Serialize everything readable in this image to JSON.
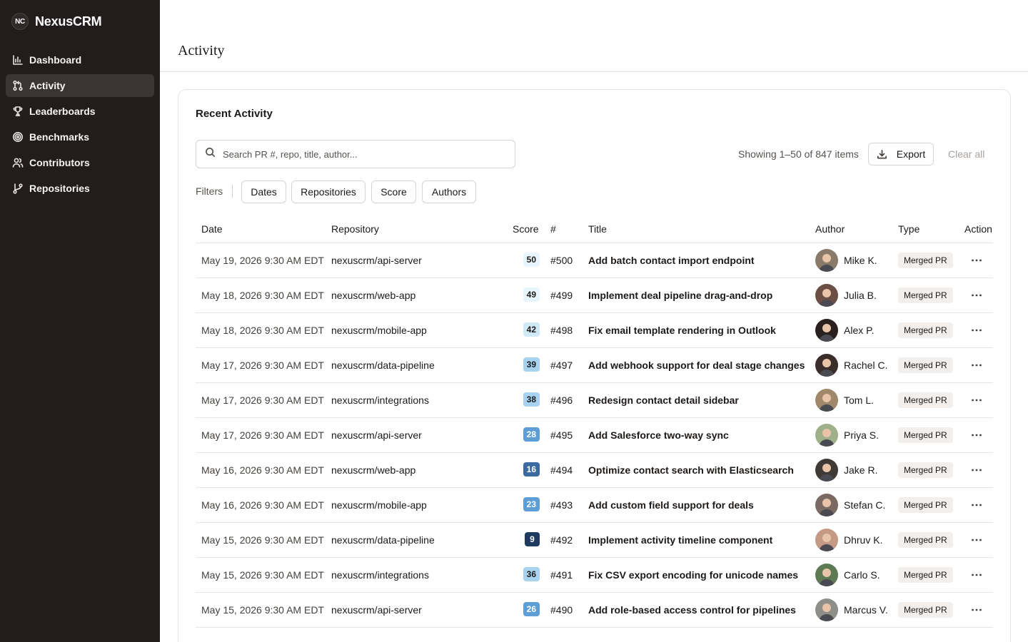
{
  "app": {
    "logo_text": "NC",
    "name": "NexusCRM"
  },
  "sidebar": {
    "items": [
      {
        "label": "Dashboard",
        "icon": "bar-chart-icon",
        "active": false
      },
      {
        "label": "Activity",
        "icon": "git-pull-request-icon",
        "active": true
      },
      {
        "label": "Leaderboards",
        "icon": "trophy-icon",
        "active": false
      },
      {
        "label": "Benchmarks",
        "icon": "target-icon",
        "active": false
      },
      {
        "label": "Contributors",
        "icon": "users-icon",
        "active": false
      },
      {
        "label": "Repositories",
        "icon": "git-branch-icon",
        "active": false
      }
    ]
  },
  "page": {
    "title": "Activity"
  },
  "card": {
    "title": "Recent Activity",
    "search_placeholder": "Search PR #, repo, title, author...",
    "showing": "Showing 1–50 of 847 items",
    "export_label": "Export",
    "clear_label": "Clear all",
    "filters_label": "Filters",
    "filters": [
      "Dates",
      "Repositories",
      "Score",
      "Authors"
    ]
  },
  "table": {
    "headers": [
      "Date",
      "Repository",
      "Score",
      "#",
      "Title",
      "Author",
      "Type",
      "Action"
    ],
    "rows": [
      {
        "date": "May 19, 2026 9:30 AM EDT",
        "repo": "nexuscrm/api-server",
        "score": "50",
        "num": "#500",
        "title": "Add batch contact import endpoint",
        "author": "Mike K.",
        "type": "Merged PR"
      },
      {
        "date": "May 18, 2026 9:30 AM EDT",
        "repo": "nexuscrm/web-app",
        "score": "49",
        "num": "#499",
        "title": "Implement deal pipeline drag-and-drop",
        "author": "Julia B.",
        "type": "Merged PR"
      },
      {
        "date": "May 18, 2026 9:30 AM EDT",
        "repo": "nexuscrm/mobile-app",
        "score": "42",
        "num": "#498",
        "title": "Fix email template rendering in Outlook",
        "author": "Alex P.",
        "type": "Merged PR"
      },
      {
        "date": "May 17, 2026 9:30 AM EDT",
        "repo": "nexuscrm/data-pipeline",
        "score": "39",
        "num": "#497",
        "title": "Add webhook support for deal stage changes",
        "author": "Rachel C.",
        "type": "Merged PR"
      },
      {
        "date": "May 17, 2026 9:30 AM EDT",
        "repo": "nexuscrm/integrations",
        "score": "38",
        "num": "#496",
        "title": "Redesign contact detail sidebar",
        "author": "Tom L.",
        "type": "Merged PR"
      },
      {
        "date": "May 17, 2026 9:30 AM EDT",
        "repo": "nexuscrm/api-server",
        "score": "28",
        "num": "#495",
        "title": "Add Salesforce two-way sync",
        "author": "Priya S.",
        "type": "Merged PR"
      },
      {
        "date": "May 16, 2026 9:30 AM EDT",
        "repo": "nexuscrm/web-app",
        "score": "16",
        "num": "#494",
        "title": "Optimize contact search with Elasticsearch",
        "author": "Jake R.",
        "type": "Merged PR"
      },
      {
        "date": "May 16, 2026 9:30 AM EDT",
        "repo": "nexuscrm/mobile-app",
        "score": "23",
        "num": "#493",
        "title": "Add custom field support for deals",
        "author": "Stefan C.",
        "type": "Merged PR"
      },
      {
        "date": "May 15, 2026 9:30 AM EDT",
        "repo": "nexuscrm/data-pipeline",
        "score": "9",
        "num": "#492",
        "title": "Implement activity timeline component",
        "author": "Dhruv K.",
        "type": "Merged PR"
      },
      {
        "date": "May 15, 2026 9:30 AM EDT",
        "repo": "nexuscrm/integrations",
        "score": "36",
        "num": "#491",
        "title": "Fix CSV export encoding for unicode names",
        "author": "Carlo S.",
        "type": "Merged PR"
      },
      {
        "date": "May 15, 2026 9:30 AM EDT",
        "repo": "nexuscrm/api-server",
        "score": "26",
        "num": "#490",
        "title": "Add role-based access control for pipelines",
        "author": "Marcus V.",
        "type": "Merged PR"
      }
    ]
  },
  "colors": {
    "sidebar_bg": "#221c1c",
    "sidebar_active": "#3b3434",
    "score_scale": [
      {
        "max": 12,
        "bg": "#1e3a5f",
        "fg": "#ffffff"
      },
      {
        "max": 20,
        "bg": "#3b6aa0",
        "fg": "#ffffff"
      },
      {
        "max": 30,
        "bg": "#5e9ed6",
        "fg": "#ffffff"
      },
      {
        "max": 40,
        "bg": "#a7d3f0",
        "fg": "#1c1917"
      },
      {
        "max": 45,
        "bg": "#cfe9f7",
        "fg": "#1c1917"
      },
      {
        "max": 100,
        "bg": "#e8f5fc",
        "fg": "#1c1917"
      }
    ],
    "avatars": [
      "#8a7a6a",
      "#6b4f44",
      "#2b2020",
      "#3a2e2a",
      "#a0896a",
      "#9fb08a",
      "#3f3a36",
      "#7a6a62",
      "#c49a84",
      "#5e7a54",
      "#8d8f88"
    ]
  }
}
